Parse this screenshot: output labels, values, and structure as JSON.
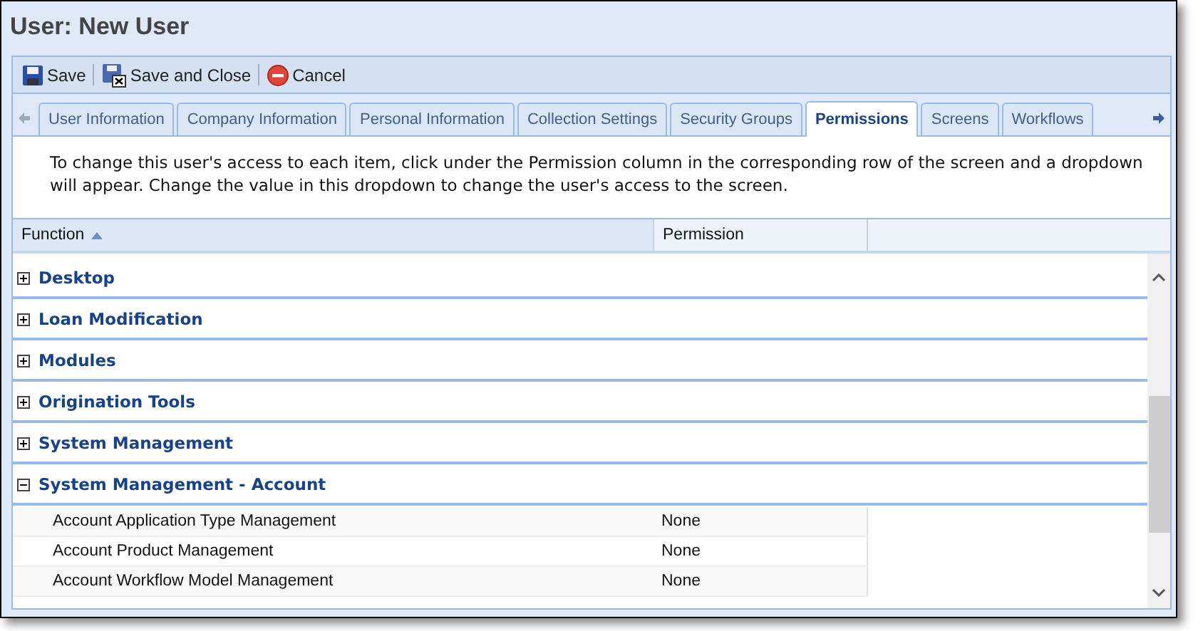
{
  "window": {
    "title": "User: New User"
  },
  "toolbar": [
    {
      "kind": "save",
      "label": "Save"
    },
    {
      "kind": "save-close",
      "label": "Save and Close"
    },
    {
      "kind": "cancel",
      "label": "Cancel"
    }
  ],
  "tabs": [
    {
      "label": "User Information",
      "selected": false
    },
    {
      "label": "Company Information",
      "selected": false
    },
    {
      "label": "Personal Information",
      "selected": false
    },
    {
      "label": "Collection Settings",
      "selected": false
    },
    {
      "label": "Security Groups",
      "selected": false
    },
    {
      "label": "Permissions",
      "selected": true
    },
    {
      "label": "Screens",
      "selected": false
    },
    {
      "label": "Workflows",
      "selected": false
    }
  ],
  "description": "To change this user's access to each item, click under the Permission column in the corresponding row of the screen and a dropdown will appear. Change the value in this dropdown to change the user's access to the screen.",
  "table": {
    "columns": [
      {
        "label": "Function",
        "sorted": true
      },
      {
        "label": "Permission",
        "sorted": false
      }
    ],
    "groups": [
      {
        "label": "Desktop",
        "expanded": false
      },
      {
        "label": "Loan Modification",
        "expanded": false
      },
      {
        "label": "Modules",
        "expanded": false
      },
      {
        "label": "Origination Tools",
        "expanded": false
      },
      {
        "label": "System Management",
        "expanded": false
      },
      {
        "label": "System Management - Account",
        "expanded": true,
        "children": [
          {
            "function": "Account Application Type Management",
            "permission": "None"
          },
          {
            "function": "Account Product Management",
            "permission": "None"
          },
          {
            "function": "Account Workflow Model Management",
            "permission": "None"
          }
        ]
      }
    ]
  }
}
